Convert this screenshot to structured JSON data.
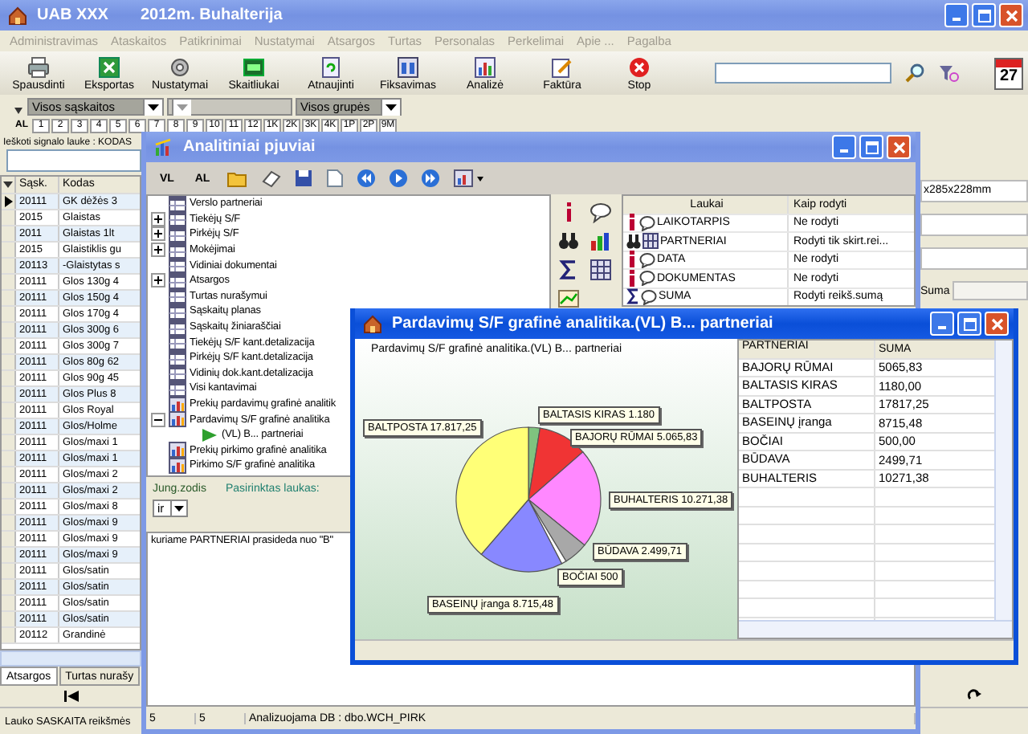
{
  "main_window": {
    "company": "UAB XXX",
    "title": "2012m. Buhalterija"
  },
  "menu": [
    "Administravimas",
    "Ataskaitos",
    "Patikrinimai",
    "Nustatymai",
    "Atsargos",
    "Turtas",
    "Personalas",
    "Perkelimai",
    "Apie ...",
    "Pagalba"
  ],
  "toolbar": [
    {
      "label": "Spausdinti",
      "kind": "print"
    },
    {
      "label": "Eksportas",
      "kind": "export"
    },
    {
      "label": "Nustatymai",
      "kind": "settings"
    },
    {
      "label": "Skaitliukai",
      "kind": "counter"
    },
    {
      "label": "Atnaujinti",
      "kind": "refresh"
    },
    {
      "label": "Fiksavimas",
      "kind": "fix"
    },
    {
      "label": "Analizė",
      "kind": "analysis"
    },
    {
      "label": "Faktūra",
      "kind": "invoice"
    },
    {
      "label": "Stop",
      "kind": "stop"
    }
  ],
  "calendar_day": "27",
  "filters": {
    "accounts": "Visos sąskaitos",
    "groups": "Visos grupės"
  },
  "period_tabs": [
    {
      "label": "AL",
      "selected": true
    },
    {
      "label": "1",
      "selected": false
    },
    {
      "label": "2",
      "selected": false
    },
    {
      "label": "3",
      "selected": false
    },
    {
      "label": "4",
      "selected": false
    },
    {
      "label": "5",
      "selected": false
    },
    {
      "label": "6",
      "selected": false
    },
    {
      "label": "7",
      "selected": false
    },
    {
      "label": "8",
      "selected": false
    },
    {
      "label": "9",
      "selected": false
    },
    {
      "label": "10",
      "selected": false
    },
    {
      "label": "11",
      "selected": false
    },
    {
      "label": "12",
      "selected": false
    },
    {
      "label": "1K",
      "selected": false
    },
    {
      "label": "2K",
      "selected": false
    },
    {
      "label": "3K",
      "selected": false
    },
    {
      "label": "4K",
      "selected": false
    },
    {
      "label": "1P",
      "selected": false
    },
    {
      "label": "2P",
      "selected": false
    },
    {
      "label": "9M",
      "selected": false
    }
  ],
  "search_label": "Ieškoti signalo lauke : KODAS",
  "grid": {
    "columns": [
      "Sąsk.",
      "Kodas"
    ],
    "rows": [
      {
        "account": "20111",
        "code": "GK dėžės 3",
        "selected": true
      },
      {
        "account": "2015",
        "code": "Glaistas",
        "selected": false
      },
      {
        "account": "2011",
        "code": "Glaistas 1lt",
        "selected": false
      },
      {
        "account": "2015",
        "code": "Glaistiklis gu",
        "selected": false
      },
      {
        "account": "20113",
        "code": "-Glaistytas s",
        "selected": false
      },
      {
        "account": "20111",
        "code": "Glos 130g 4",
        "selected": false
      },
      {
        "account": "20111",
        "code": "Glos 150g 4",
        "selected": false
      },
      {
        "account": "20111",
        "code": "Glos 170g 4",
        "selected": false
      },
      {
        "account": "20111",
        "code": "Glos 300g 6",
        "selected": false
      },
      {
        "account": "20111",
        "code": "Glos 300g 7",
        "selected": false
      },
      {
        "account": "20111",
        "code": "Glos 80g 62",
        "selected": false
      },
      {
        "account": "20111",
        "code": "Glos 90g 45",
        "selected": false
      },
      {
        "account": "20111",
        "code": "Glos Plus 8",
        "selected": false
      },
      {
        "account": "20111",
        "code": "Glos Royal",
        "selected": false
      },
      {
        "account": "20111",
        "code": "Glos/Holme",
        "selected": false
      },
      {
        "account": "20111",
        "code": "Glos/maxi 1",
        "selected": false
      },
      {
        "account": "20111",
        "code": "Glos/maxi 1",
        "selected": false
      },
      {
        "account": "20111",
        "code": "Glos/maxi 2",
        "selected": false
      },
      {
        "account": "20111",
        "code": "Glos/maxi 2",
        "selected": false
      },
      {
        "account": "20111",
        "code": "Glos/maxi 8",
        "selected": false
      },
      {
        "account": "20111",
        "code": "Glos/maxi 9",
        "selected": false
      },
      {
        "account": "20111",
        "code": "Glos/maxi 9",
        "selected": false
      },
      {
        "account": "20111",
        "code": "Glos/maxi 9",
        "selected": false
      },
      {
        "account": "20111",
        "code": "Glos/satin",
        "selected": false
      },
      {
        "account": "20111",
        "code": "Glos/satin",
        "selected": false
      },
      {
        "account": "20111",
        "code": "Glos/satin",
        "selected": false
      },
      {
        "account": "20111",
        "code": "Glos/satin",
        "selected": false
      },
      {
        "account": "20112",
        "code": "Grandinė",
        "selected": false
      }
    ]
  },
  "bottom_tabs": [
    {
      "label": "Atsargos",
      "selected": true
    },
    {
      "label": "Turtas nurašy",
      "selected": false
    }
  ],
  "status_text": "Lauko SASKAITA reikšmės",
  "side_panel": {
    "size_field": "x285x228mm",
    "sum_label": "Suma"
  },
  "analytics_window": {
    "title": "Analitiniai pjuviai",
    "toolbar_text": [
      "VL",
      "AL"
    ],
    "tree": [
      {
        "label": "Verslo partneriai",
        "kind": "table",
        "expandable": false
      },
      {
        "label": "Tiekėjų S/F",
        "kind": "table",
        "expandable": true,
        "expanded": false
      },
      {
        "label": "Pirkėjų S/F",
        "kind": "table",
        "expandable": true,
        "expanded": false
      },
      {
        "label": "Mokėjimai",
        "kind": "table",
        "expandable": true,
        "expanded": false
      },
      {
        "label": "Vidiniai dokumentai",
        "kind": "table",
        "expandable": false
      },
      {
        "label": "Atsargos",
        "kind": "table",
        "expandable": true,
        "expanded": false
      },
      {
        "label": "Turtas nurašymui",
        "kind": "table",
        "expandable": false
      },
      {
        "label": "Sąskaitų planas",
        "kind": "table",
        "expandable": false
      },
      {
        "label": "Sąskaitų žiniaraščiai",
        "kind": "table",
        "expandable": false
      },
      {
        "label": "Tiekėjų S/F kant.detalizacija",
        "kind": "table",
        "expandable": false
      },
      {
        "label": "Pirkėjų S/F kant.detalizacija",
        "kind": "table",
        "expandable": false
      },
      {
        "label": "Vidinių dok.kant.detalizacija",
        "kind": "table",
        "expandable": false
      },
      {
        "label": "Visi kantavimai",
        "kind": "table",
        "expandable": false
      },
      {
        "label": "Prekių pardavimų grafinė analitik",
        "kind": "chart",
        "expandable": false
      },
      {
        "label": "Pardavimų S/F grafinė analitika",
        "kind": "chart",
        "expandable": true,
        "expanded": true,
        "children": [
          {
            "label": "(VL) B... partneriai",
            "kind": "view",
            "expandable": false
          }
        ]
      },
      {
        "label": "Prekių pirkimo grafinė analitika",
        "kind": "chart",
        "expandable": false
      },
      {
        "label": "Pirkimo S/F grafinė analitika",
        "kind": "chart",
        "expandable": false
      }
    ],
    "fields": {
      "columns": [
        "Laukai",
        "Kaip rodyti"
      ],
      "rows": [
        {
          "name": "LAIKOTARPIS",
          "display": "Ne rodyti",
          "kind": "info"
        },
        {
          "name": "PARTNERIAI",
          "display": "Rodyti tik skirt.rei...",
          "kind": "search"
        },
        {
          "name": "DATA",
          "display": "Ne rodyti",
          "kind": "info"
        },
        {
          "name": "DOKUMENTAS",
          "display": "Ne rodyti",
          "kind": "info"
        },
        {
          "name": "SUMA",
          "display": "Rodyti reikš.sumą",
          "kind": "sum"
        }
      ]
    },
    "join_label": "Jung.zodis",
    "join_value": "ir",
    "selected_field_label": "Pasirinktas laukas:",
    "condition": "kuriame PARTNERIAI prasideda nuo \"B\"",
    "status": [
      "5",
      "5",
      "Analizuojama DB : dbo.WCH_PIRK"
    ]
  },
  "chart_window": {
    "title": "Pardavimų S/F grafinė analitika.(VL) B... partneriai",
    "chart_data": {
      "type": "pie",
      "title": "Pardavimų S/F grafinė analitika.(VL) B... partneriai",
      "categories": [
        "BALTASIS KIRAS",
        "BAJORŲ RŪMAI",
        "BUHALTERIS",
        "BŪDAVA",
        "BOČIAI",
        "BASEINŲ įranga",
        "BALTPOSTA"
      ],
      "values": [
        1180,
        5065.83,
        10271.38,
        2499.71,
        500,
        8715.48,
        17817.25
      ],
      "value_labels": [
        "1.180",
        "5.065,83",
        "10.271,38",
        "2.499,71",
        "500",
        "8.715,48",
        "17.817,25"
      ]
    },
    "table": {
      "columns": [
        "PARTNERIAI",
        "SUMA"
      ],
      "rows": [
        [
          "BAJORŲ RŪMAI",
          "5065,83"
        ],
        [
          "BALTASIS KIRAS",
          "1180,00"
        ],
        [
          "BALTPOSTA",
          "17817,25"
        ],
        [
          "BASEINŲ įranga",
          "8715,48"
        ],
        [
          "BOČIAI",
          "500,00"
        ],
        [
          "BŪDAVA",
          "2499,71"
        ],
        [
          "BUHALTERIS",
          "10271,38"
        ]
      ]
    }
  }
}
